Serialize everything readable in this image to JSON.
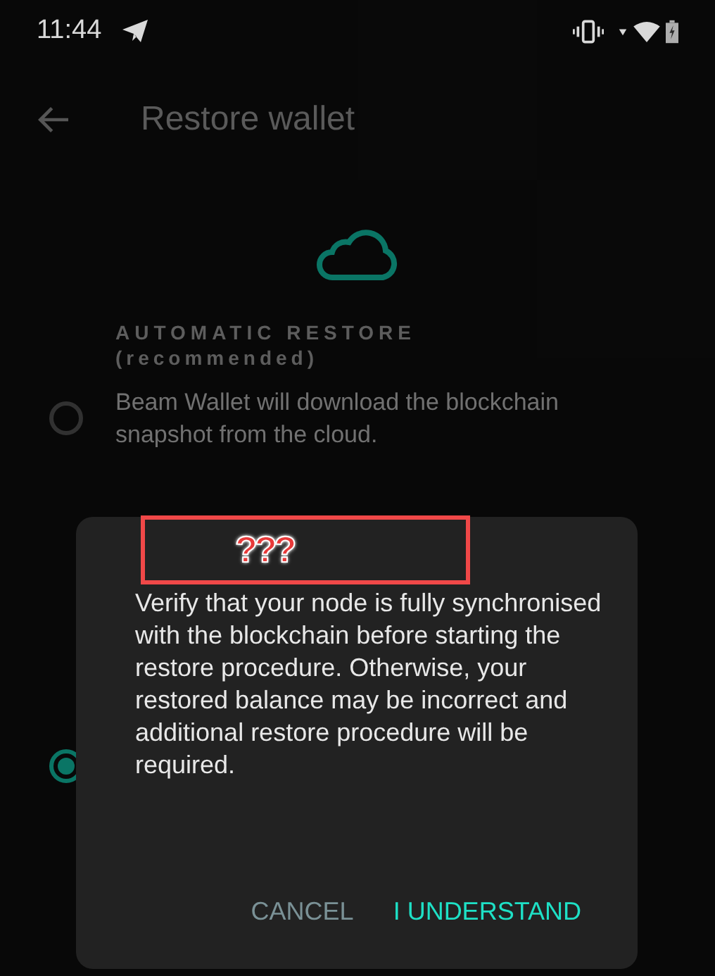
{
  "status_bar": {
    "time": "11:44"
  },
  "app_bar": {
    "title": "Restore wallet"
  },
  "section": {
    "heading": "AUTOMATIC RESTORE",
    "subheading": "(recommended)"
  },
  "options": [
    {
      "text": "Beam Wallet will download the blockchain snapshot from the cloud.",
      "selected": false
    },
    {
      "selected": true
    }
  ],
  "dialog": {
    "message": "Verify that your node is fully synchronised with the blockchain before starting the restore procedure. Otherwise, your restored balance may be incorrect and additional restore procedure will be required.",
    "buttons": [
      {
        "label": "CANCEL",
        "kind": "secondary"
      },
      {
        "label": "I UNDERSTAND",
        "kind": "primary"
      }
    ]
  },
  "annotation": {
    "text": "???"
  }
}
